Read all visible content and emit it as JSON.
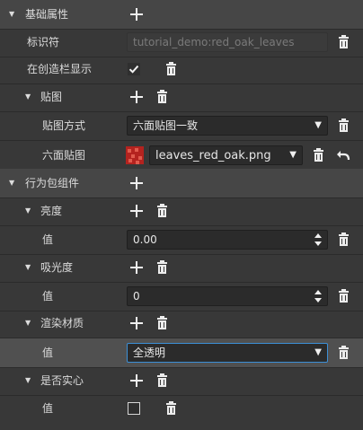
{
  "sections": {
    "basic": {
      "label": "基础属性"
    },
    "behavior": {
      "label": "行为包组件"
    }
  },
  "identifier": {
    "label": "标识符",
    "value": "tutorial_demo:red_oak_leaves"
  },
  "creative": {
    "label": "在创造栏显示",
    "checked": true
  },
  "texture": {
    "label": "贴图",
    "mode_label": "贴图方式",
    "mode_value": "六面贴图一致",
    "six_label": "六面贴图",
    "file_value": "leaves_red_oak.png"
  },
  "brightness": {
    "label": "亮度",
    "value_label": "值",
    "value": "0.00"
  },
  "absorption": {
    "label": "吸光度",
    "value_label": "值",
    "value": "0"
  },
  "render": {
    "label": "渲染材质",
    "value_label": "值",
    "value": "全透明"
  },
  "solid": {
    "label": "是否实心",
    "value_label": "值",
    "checked": false
  },
  "icons": {
    "expand": "triangle-down-icon",
    "add": "plus-icon",
    "delete": "trash-icon",
    "dropdown": "caret-down-icon",
    "spin": "spinner-icon",
    "undo": "undo-icon"
  },
  "colors": {
    "panel": "#383838",
    "section": "#464646",
    "highlight": "#505050",
    "field": "#2b2b2b",
    "focus": "#3c8fd6",
    "texture": "#b4231f"
  }
}
